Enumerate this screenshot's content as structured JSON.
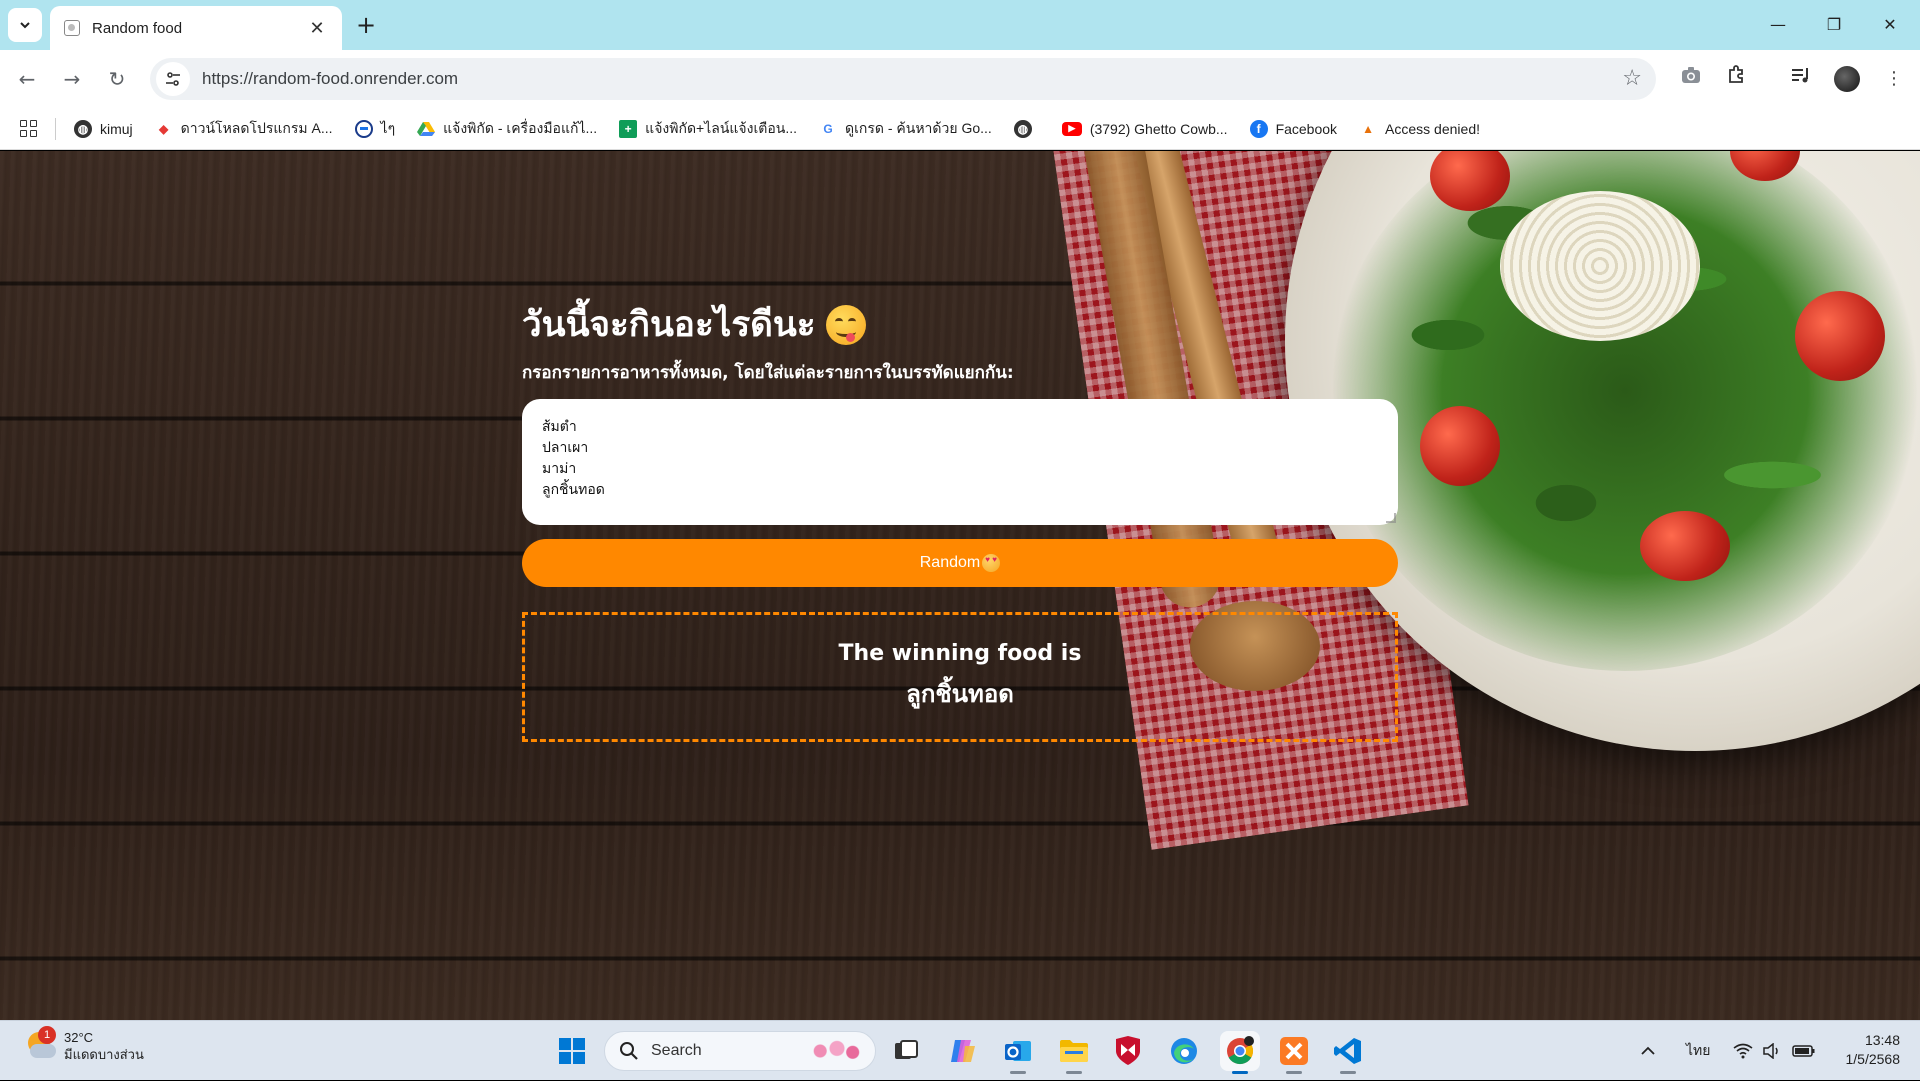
{
  "browser": {
    "tab_title": "Random food",
    "url": "https://random-food.onrender.com",
    "bookmarks": [
      {
        "label": "kimuj",
        "icon": "globe-icon"
      },
      {
        "label": "ดาวน์โหลดโปรแกรม A...",
        "icon": "download-site-icon"
      },
      {
        "label": "ไๆ",
        "icon": "circle-app-icon"
      },
      {
        "label": "แจ้งพิกัด - เครื่องมือแก้ไ...",
        "icon": "google-drive-icon"
      },
      {
        "label": "แจ้งพิกัด+ไลน์แจ้งเตือน...",
        "icon": "google-sheets-icon"
      },
      {
        "label": "ดูเกรด - ค้นหาด้วย Go...",
        "icon": "google-icon"
      },
      {
        "label": "",
        "icon": "globe-icon"
      },
      {
        "label": "(3792) Ghetto Cowb...",
        "icon": "youtube-icon"
      },
      {
        "label": "Facebook",
        "icon": "facebook-icon"
      },
      {
        "label": "Access denied!",
        "icon": "site-logo-icon"
      }
    ]
  },
  "page": {
    "heading": "วันนี้จะกินอะไรดีนะ",
    "subheading": "กรอกรายการอาหารทั้งหมด, โดยใส่แต่ละรายการในบรรทัดแยกกัน:",
    "food_list": "ส้มตำ\nปลาเผา\nมาม่า\nลูกชิ้นทอด",
    "random_button": "Random",
    "result_label": "The winning food is",
    "result_value": "ลูกชิ้นทอด"
  },
  "taskbar": {
    "weather_temp": "32°C",
    "weather_desc": "มีแดดบางส่วน",
    "weather_badge": "1",
    "search_label": "Search",
    "language": "ไทย",
    "time": "13:48",
    "date": "1/5/2568"
  },
  "colors": {
    "accent": "#ff8800",
    "tabstrip": "#b0e4ef"
  }
}
